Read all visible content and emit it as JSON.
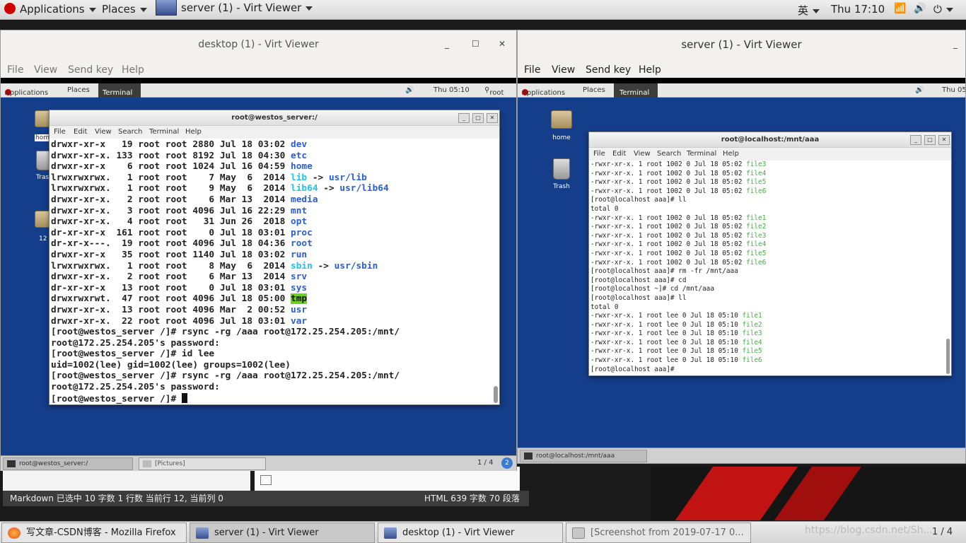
{
  "topbar": {
    "applications": "Applications",
    "places": "Places",
    "active_window": "server (1) - Virt Viewer",
    "input_method": "英",
    "clock": "Thu 17:10"
  },
  "left_window": {
    "title": "desktop (1) - Virt Viewer",
    "menu": [
      "File",
      "View",
      "Send key",
      "Help"
    ],
    "guest_panel": {
      "applications": "Applications",
      "places": "Places",
      "terminal": "Terminal",
      "clock": "Thu 05:10",
      "user": "root"
    },
    "desktop_icons": {
      "home": "hom",
      "trash": "Tras",
      "folder": "12"
    },
    "terminal": {
      "title": "root@westos_server:/",
      "menu": [
        "File",
        "Edit",
        "View",
        "Search",
        "Terminal",
        "Help"
      ],
      "lines": [
        [
          {
            "t": "drwxr-xr-x   19 root root 2880 Jul 18 03:02 "
          },
          {
            "t": "dev",
            "c": "blue"
          }
        ],
        [
          {
            "t": "drwxr-xr-x. 133 root root 8192 Jul 18 04:30 "
          },
          {
            "t": "etc",
            "c": "blue"
          }
        ],
        [
          {
            "t": "drwxr-xr-x    6 root root 1024 Jul 16 04:59 "
          },
          {
            "t": "home",
            "c": "blue"
          }
        ],
        [
          {
            "t": "lrwxrwxrwx.   1 root root    7 May  6  2014 "
          },
          {
            "t": "lib",
            "c": "cyan"
          },
          {
            "t": " -> "
          },
          {
            "t": "usr/lib",
            "c": "blue"
          }
        ],
        [
          {
            "t": "lrwxrwxrwx.   1 root root    9 May  6  2014 "
          },
          {
            "t": "lib64",
            "c": "cyan"
          },
          {
            "t": " -> "
          },
          {
            "t": "usr/lib64",
            "c": "blue"
          }
        ],
        [
          {
            "t": "drwxr-xr-x.   2 root root    6 Mar 13  2014 "
          },
          {
            "t": "media",
            "c": "blue"
          }
        ],
        [
          {
            "t": "drwxr-xr-x.   3 root root 4096 Jul 16 22:29 "
          },
          {
            "t": "mnt",
            "c": "blue"
          }
        ],
        [
          {
            "t": "drwxr-xr-x.   4 root root   31 Jun 26  2018 "
          },
          {
            "t": "opt",
            "c": "blue"
          }
        ],
        [
          {
            "t": "dr-xr-xr-x  161 root root    0 Jul 18 03:01 "
          },
          {
            "t": "proc",
            "c": "blue"
          }
        ],
        [
          {
            "t": "dr-xr-x---.  19 root root 4096 Jul 18 04:36 "
          },
          {
            "t": "root",
            "c": "blue"
          }
        ],
        [
          {
            "t": "drwxr-xr-x   35 root root 1140 Jul 18 03:02 "
          },
          {
            "t": "run",
            "c": "blue"
          }
        ],
        [
          {
            "t": "lrwxrwxrwx.   1 root root    8 May  6  2014 "
          },
          {
            "t": "sbin",
            "c": "cyan"
          },
          {
            "t": " -> "
          },
          {
            "t": "usr/sbin",
            "c": "blue"
          }
        ],
        [
          {
            "t": "drwxr-xr-x.   2 root root    6 Mar 13  2014 "
          },
          {
            "t": "srv",
            "c": "blue"
          }
        ],
        [
          {
            "t": "dr-xr-xr-x   13 root root    0 Jul 18 03:01 "
          },
          {
            "t": "sys",
            "c": "blue"
          }
        ],
        [
          {
            "t": "drwxrwxrwt.  47 root root 4096 Jul 18 05:00 "
          },
          {
            "t": "tmp",
            "c": "hl"
          }
        ],
        [
          {
            "t": "drwxr-xr-x.  13 root root 4096 Mar  2 00:52 "
          },
          {
            "t": "usr",
            "c": "blue"
          }
        ],
        [
          {
            "t": "drwxr-xr-x.  22 root root 4096 Jul 18 03:01 "
          },
          {
            "t": "var",
            "c": "blue"
          }
        ],
        [
          {
            "t": "[root@westos_server /]# rsync -rg /aaa root@172.25.254.205:/mnt/"
          }
        ],
        [
          {
            "t": "root@172.25.254.205's password:"
          }
        ],
        [
          {
            "t": "[root@westos_server /]# id lee"
          }
        ],
        [
          {
            "t": "uid=1002(lee) gid=1002(lee) groups=1002(lee)"
          }
        ],
        [
          {
            "t": "[root@westos_server /]# rsync -rg /aaa root@172.25.254.205:/mnt/"
          }
        ],
        [
          {
            "t": "root@172.25.254.205's password:"
          }
        ],
        [
          {
            "t": "[root@westos_server /]# "
          }
        ]
      ]
    },
    "taskbar": {
      "terminal": "root@westos_server:/",
      "pictures": "[Pictures]",
      "workspace": "1 / 4"
    }
  },
  "right_window": {
    "title": "server (1) - Virt Viewer",
    "menu": [
      "File",
      "View",
      "Send key",
      "Help"
    ],
    "guest_panel": {
      "applications": "Applications",
      "places": "Places",
      "terminal": "Terminal",
      "clock": "Thu 05"
    },
    "desktop_icons": {
      "home": "home",
      "trash": "Trash"
    },
    "terminal": {
      "title": "root@localhost:/mnt/aaa",
      "menu": [
        "File",
        "Edit",
        "View",
        "Search",
        "Terminal",
        "Help"
      ],
      "lines": [
        [
          {
            "t": "-rwxr-xr-x. 1 root 1002 0 Jul 18 05:02 "
          },
          {
            "t": "file3",
            "c": "green"
          }
        ],
        [
          {
            "t": "-rwxr-xr-x. 1 root 1002 0 Jul 18 05:02 "
          },
          {
            "t": "file4",
            "c": "green"
          }
        ],
        [
          {
            "t": "-rwxr-xr-x. 1 root 1002 0 Jul 18 05:02 "
          },
          {
            "t": "file5",
            "c": "green"
          }
        ],
        [
          {
            "t": "-rwxr-xr-x. 1 root 1002 0 Jul 18 05:02 "
          },
          {
            "t": "file6",
            "c": "green"
          }
        ],
        [
          {
            "t": "[root@localhost aaa]# ll"
          }
        ],
        [
          {
            "t": "total 0"
          }
        ],
        [
          {
            "t": "-rwxr-xr-x. 1 root 1002 0 Jul 18 05:02 "
          },
          {
            "t": "file1",
            "c": "green"
          }
        ],
        [
          {
            "t": "-rwxr-xr-x. 1 root 1002 0 Jul 18 05:02 "
          },
          {
            "t": "file2",
            "c": "green"
          }
        ],
        [
          {
            "t": "-rwxr-xr-x. 1 root 1002 0 Jul 18 05:02 "
          },
          {
            "t": "file3",
            "c": "green"
          }
        ],
        [
          {
            "t": "-rwxr-xr-x. 1 root 1002 0 Jul 18 05:02 "
          },
          {
            "t": "file4",
            "c": "green"
          }
        ],
        [
          {
            "t": "-rwxr-xr-x. 1 root 1002 0 Jul 18 05:02 "
          },
          {
            "t": "file5",
            "c": "green"
          }
        ],
        [
          {
            "t": "-rwxr-xr-x. 1 root 1002 0 Jul 18 05:02 "
          },
          {
            "t": "file6",
            "c": "green"
          }
        ],
        [
          {
            "t": "[root@localhost aaa]# rm -fr /mnt/aaa"
          }
        ],
        [
          {
            "t": "[root@localhost aaa]# cd"
          }
        ],
        [
          {
            "t": "[root@localhost ~]# cd /mnt/aaa"
          }
        ],
        [
          {
            "t": "[root@localhost aaa]# ll"
          }
        ],
        [
          {
            "t": "total 0"
          }
        ],
        [
          {
            "t": "-rwxr-xr-x. 1 root lee 0 Jul 18 05:10 "
          },
          {
            "t": "file1",
            "c": "green"
          }
        ],
        [
          {
            "t": "-rwxr-xr-x. 1 root lee 0 Jul 18 05:10 "
          },
          {
            "t": "file2",
            "c": "green"
          }
        ],
        [
          {
            "t": "-rwxr-xr-x. 1 root lee 0 Jul 18 05:10 "
          },
          {
            "t": "file3",
            "c": "green"
          }
        ],
        [
          {
            "t": "-rwxr-xr-x. 1 root lee 0 Jul 18 05:10 "
          },
          {
            "t": "file4",
            "c": "green"
          }
        ],
        [
          {
            "t": "-rwxr-xr-x. 1 root lee 0 Jul 18 05:10 "
          },
          {
            "t": "file5",
            "c": "green"
          }
        ],
        [
          {
            "t": "-rwxr-xr-x. 1 root lee 0 Jul 18 05:10 "
          },
          {
            "t": "file6",
            "c": "green"
          }
        ],
        [
          {
            "t": "[root@localhost aaa]# "
          }
        ]
      ]
    },
    "taskbar": {
      "terminal": "root@localhost:/mnt/aaa"
    }
  },
  "editor_status": {
    "left": "Markdown 已选中  10 字数  1 行数  当前行 12, 当前列 0",
    "right": "HTML  639 字数  70 段落"
  },
  "bottom_taskbar": {
    "items": [
      "写文章-CSDN博客 - Mozilla Firefox",
      "server (1) - Virt Viewer",
      "desktop (1) - Virt Viewer",
      "[Screenshot from 2019-07-17 0..."
    ],
    "workspace": "1 / 4",
    "watermark": "https://blog.csdn.net/Sh..."
  },
  "colors": {
    "guest_desktop": "#153e8a",
    "ls_dir": "#2a5ed8",
    "ls_link": "#1fc4e8",
    "ls_exec": "#3fb23f",
    "tmp_highlight": "#6ecf1e"
  }
}
